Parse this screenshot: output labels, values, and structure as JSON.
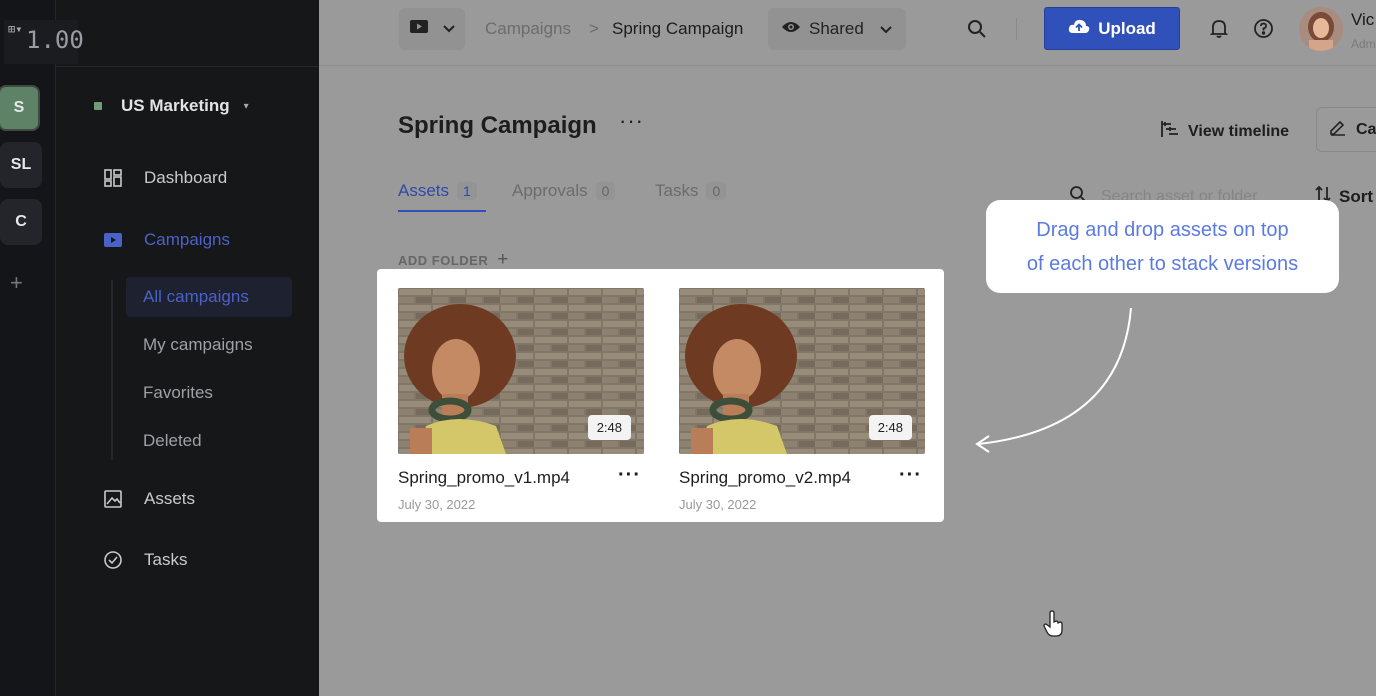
{
  "overlay": {
    "version": "1.00"
  },
  "workspaces": {
    "items": [
      {
        "label": "S",
        "active": true
      },
      {
        "label": "SL",
        "active": false
      },
      {
        "label": "C",
        "active": false
      }
    ],
    "add": "+"
  },
  "sidebar": {
    "org_name": "US Marketing",
    "nav": {
      "dashboard": "Dashboard",
      "campaigns": "Campaigns",
      "assets": "Assets",
      "tasks": "Tasks"
    },
    "campaigns_sub": {
      "all": "All campaigns",
      "mine": "My campaigns",
      "favorites": "Favorites",
      "deleted": "Deleted"
    }
  },
  "topbar": {
    "breadcrumb_root": "Campaigns",
    "breadcrumb_sep": ">",
    "breadcrumb_current": "Spring Campaign",
    "share_label": "Shared",
    "upload_label": "Upload",
    "user_name": "Vic",
    "user_role": "Adm"
  },
  "page": {
    "title": "Spring Campaign",
    "more": "···",
    "view_timeline": "View timeline",
    "edit_label": "Ca",
    "tabs": [
      {
        "label": "Assets",
        "count": "1",
        "active": true
      },
      {
        "label": "Approvals",
        "count": "0",
        "active": false
      },
      {
        "label": "Tasks",
        "count": "0",
        "active": false
      }
    ],
    "search_placeholder": "Search asset or folder",
    "sort_label": "Sort",
    "add_folder": "ADD FOLDER",
    "add_folder_plus": "+"
  },
  "assets": [
    {
      "name": "Spring_promo_v1.mp4",
      "date": "July 30, 2022",
      "duration": "2:48",
      "more": "···"
    },
    {
      "name": "Spring_promo_v2.mp4",
      "date": "July 30, 2022",
      "duration": "2:48",
      "more": "···"
    }
  ],
  "tooltip": {
    "line1": "Drag and drop assets on top",
    "line2": "of each other to stack versions"
  },
  "colors": {
    "accent": "#3051b9",
    "active_nav": "#4a62c8",
    "workspace_active": "#5e8266",
    "tooltip_text": "#5b7be0"
  }
}
